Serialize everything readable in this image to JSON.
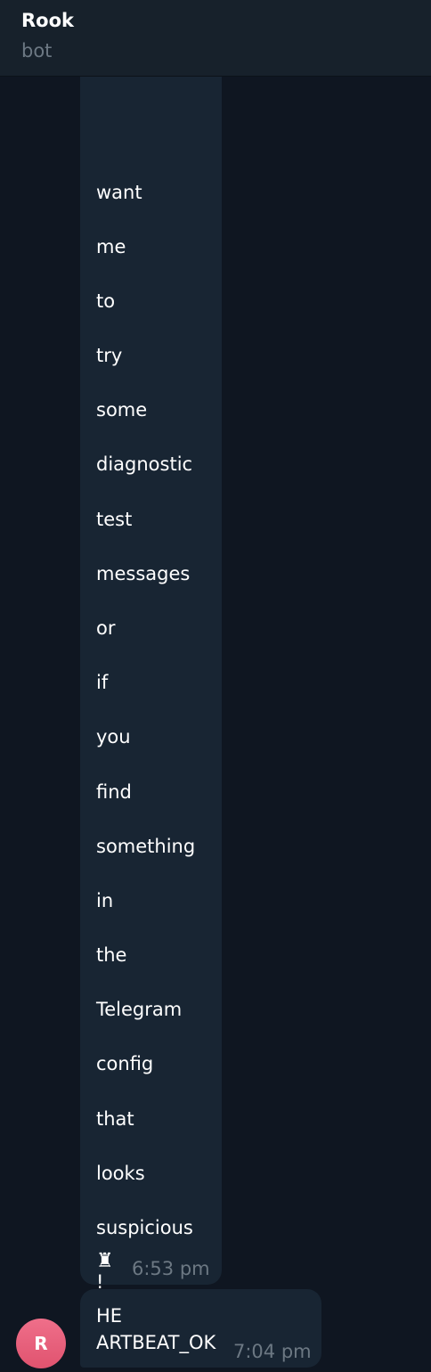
{
  "header": {
    "title": "Rook",
    "subtitle": "bot"
  },
  "messages": [
    {
      "words": [
        "want",
        "me",
        "to",
        "try",
        "some",
        "diagnostic",
        "test",
        "messages",
        "or",
        "if",
        "you",
        "find",
        "something",
        "in",
        "the",
        "Telegram",
        "config",
        "that",
        "looks",
        "suspicious",
        "!"
      ],
      "icon": "rook-chess-icon",
      "icon_glyph": "♜",
      "time": "6:53 pm"
    },
    {
      "lines": [
        "HE",
        "ARTBEAT_OK"
      ],
      "time": "7:04 pm",
      "avatar_letter": "R"
    }
  ],
  "colors": {
    "background": "#0f1621",
    "header": "#17212b",
    "bubble": "#182533",
    "muted_text": "#6c7883",
    "avatar_gradient_top": "#ef6f8a",
    "avatar_gradient_bottom": "#e0536f"
  }
}
